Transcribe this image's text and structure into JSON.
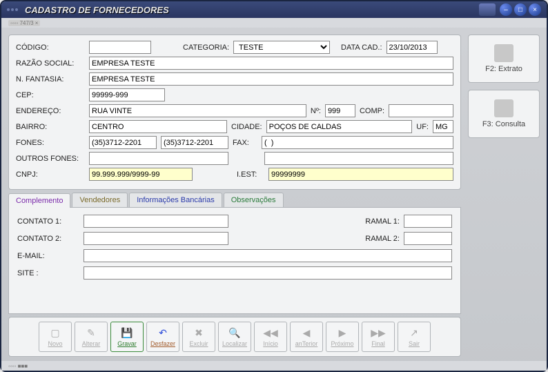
{
  "window": {
    "title": "CADASTRO DE FORNECEDORES",
    "subbar": "◦◦◦◦ 747/3 ×"
  },
  "labels": {
    "codigo": "CÓDIGO:",
    "categoria": "CATEGORIA:",
    "data_cad": "DATA CAD.:",
    "razao": "RAZÃO SOCIAL:",
    "fantasia": "N. FANTASIA:",
    "cep": "CEP:",
    "endereco": "ENDEREÇO:",
    "numero": "Nº:",
    "comp": "COMP:",
    "bairro": "BAIRRO:",
    "cidade": "CIDADE:",
    "uf": "UF:",
    "fones": "FONES:",
    "fax": "FAX:",
    "outros_fones": "OUTROS FONES:",
    "cnpj": "CNPJ:",
    "iest": "I.EST:",
    "contato1": "CONTATO 1:",
    "contato2": "CONTATO 2:",
    "ramal1": "RAMAL 1:",
    "ramal2": "RAMAL 2:",
    "email": "E-MAIL:",
    "site": "SITE :"
  },
  "values": {
    "codigo": "",
    "categoria": "TESTE",
    "data_cad": "23/10/2013",
    "razao": "EMPRESA TESTE",
    "fantasia": "EMPRESA TESTE",
    "cep": "99999-999",
    "endereco": "RUA VINTE",
    "numero": "999",
    "comp": "",
    "bairro": "CENTRO",
    "cidade": "POÇOS DE CALDAS",
    "uf": "MG",
    "fone1": "(35)3712-2201",
    "fone2": "(35)3712-2201",
    "fax": "(  )",
    "outros1": "",
    "outros2": "",
    "cnpj": "99.999.999/9999-99",
    "iest": "99999999",
    "contato1": "",
    "contato2": "",
    "ramal1": "",
    "ramal2": "",
    "email": "",
    "site": ""
  },
  "side": {
    "extrato": "F2: Extrato",
    "consulta": "F3: Consulta"
  },
  "tabs": {
    "complemento": "Complemento",
    "vendedores": "Vendedores",
    "bancarias": "Informações Bancárias",
    "observacoes": "Observações"
  },
  "toolbar": {
    "novo": "Novo",
    "alterar": "Alterar",
    "gravar": "Gravar",
    "desfazer": "Desfazer",
    "excluir": "Excluir",
    "localizar": "Localizar",
    "inicio": "Início",
    "anterior": "anTerior",
    "proximo": "Próximo",
    "final": "Final",
    "sair": "Sair"
  }
}
